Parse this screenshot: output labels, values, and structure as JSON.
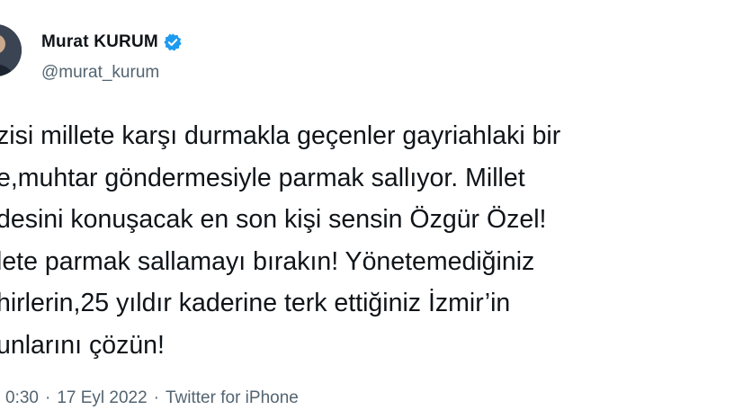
{
  "author": {
    "display_name": "Murat KURUM",
    "handle": "@murat_kurum",
    "verified_icon": "verified-badge-icon",
    "verified_color": "#1d9bf0"
  },
  "tweet": {
    "lines": [
      "zisi millete karşı durmakla geçenler gayriahlaki bir",
      "e,muhtar göndermesiyle parmak sallıyor. Millet",
      "desini konuşacak en son kişi sensin Özgür Özel!",
      "lete parmak sallamayı bırakın! Yönetemediğiniz",
      "hirlerin,25 yıldır kaderine terk ettiğiniz İzmir’in",
      "unlarını çözün!"
    ]
  },
  "meta": {
    "time": "0:30",
    "separator": "·",
    "date": "17 Eyl 2022",
    "source": "Twitter for iPhone"
  }
}
